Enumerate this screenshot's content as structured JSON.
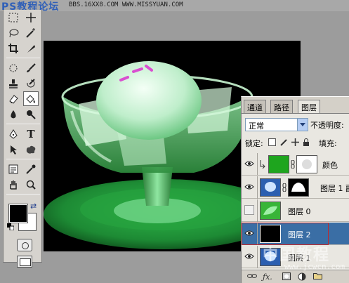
{
  "watermark": {
    "brand": "PS教程论坛",
    "site": "BBS.16XX8.COM WWW.MISSYUAN.COM",
    "bottom_brand": "中国教程",
    "bottom_url": "www.jcwcn.com"
  },
  "toolbox": {
    "foreground_color": "#000000",
    "background_color": "#ffffff",
    "active_tool": "paint-bucket",
    "text_tool_glyph": "T"
  },
  "layers_panel": {
    "tabs": [
      "通道",
      "路径",
      "图层"
    ],
    "active_tab": "图层",
    "blend_mode": "正常",
    "opacity_label": "不透明度:",
    "lock_label": "锁定:",
    "fill_label": "填充:",
    "layers": [
      {
        "name": "颜色",
        "thumb_color": "#1ea51e",
        "visible": true,
        "selected": false
      },
      {
        "name": "图层 1 副",
        "thumb_color": "#2c5fb0",
        "visible": true,
        "selected": false
      },
      {
        "name": "图层 0",
        "thumb_color": "#38b538",
        "visible": false,
        "selected": false
      },
      {
        "name": "图层 2",
        "thumb_color": "#000000",
        "visible": true,
        "selected": true
      },
      {
        "name": "图层 1",
        "thumb_color": "#2c5fb0",
        "visible": true,
        "selected": false
      }
    ],
    "footer_icons": [
      "link-icon",
      "fx-icon",
      "mask-icon",
      "adjustment-icon",
      "folder-icon"
    ]
  },
  "colors": {
    "selection": "#3a6ea5",
    "highlight_box": "#c0282c",
    "panel_bg": "#e9e7e1"
  }
}
